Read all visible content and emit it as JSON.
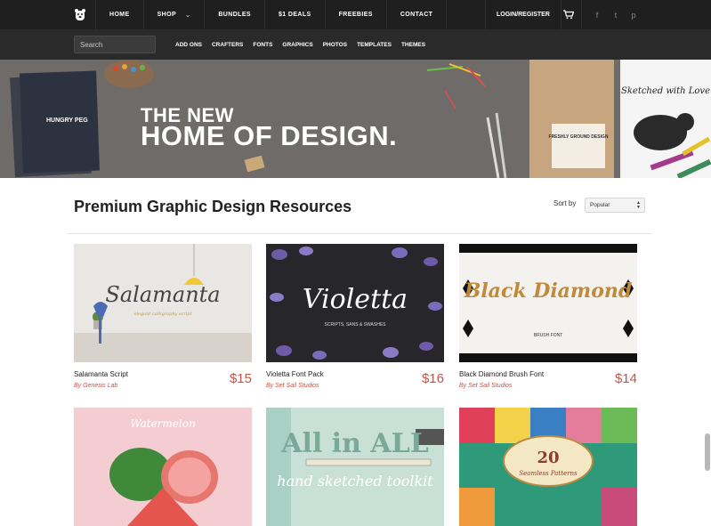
{
  "topnav": {
    "items": [
      {
        "label": "HOME"
      },
      {
        "label": "SHOP"
      },
      {
        "label": "BUNDLES"
      },
      {
        "label": "$1 DEALS"
      },
      {
        "label": "FREEBIES"
      },
      {
        "label": "CONTACT"
      }
    ],
    "login_label": "LOGIN/REGISTER",
    "social": [
      "f",
      "t",
      "p"
    ]
  },
  "subnav": {
    "search_placeholder": "Search",
    "items": [
      "ADD ONS",
      "CRAFTERS",
      "FONTS",
      "GRAPHICS",
      "PHOTOS",
      "TEMPLATES",
      "THEMES"
    ]
  },
  "hero": {
    "line1": "THE NEW",
    "line2": "HOME OF DESIGN.",
    "notebook_text": "HUNGRY PEG",
    "bag_text": "FRESHLY GROUND DESIGN",
    "sketch_text": "Sketched with Love"
  },
  "section": {
    "title": "Premium Graphic Design Resources",
    "sort_label": "Sort by",
    "sort_value": "Popular"
  },
  "products": [
    {
      "name": "Salamanta Script",
      "author": "By Genesis Lab",
      "price": "$15",
      "thumb_title": "Salamanta",
      "thumb_sub": "elegant calligraphy script"
    },
    {
      "name": "Violetta Font Pack",
      "author": "By Set Sail Studios",
      "price": "$16",
      "thumb_title": "Violetta",
      "thumb_sub": "SCRIPTS, SANS & SWASHES"
    },
    {
      "name": "Black Diamond Brush Font",
      "author": "By Set Sail Studios",
      "price": "$14",
      "thumb_title": "Black Diamond",
      "thumb_sub": "BRUSH FONT"
    },
    {
      "name": "",
      "author": "",
      "price": "",
      "thumb_title": "Watermelon",
      "thumb_sub": ""
    },
    {
      "name": "",
      "author": "",
      "price": "",
      "thumb_title": "All in ALL",
      "thumb_sub": "hand sketched toolkit"
    },
    {
      "name": "",
      "author": "",
      "price": "",
      "thumb_title": "20",
      "thumb_sub": "Seamless Patterns"
    }
  ],
  "colors": {
    "topbar": "#1f1f1f",
    "subbar": "#2a2a2a",
    "accent_price": "#c0564a"
  }
}
